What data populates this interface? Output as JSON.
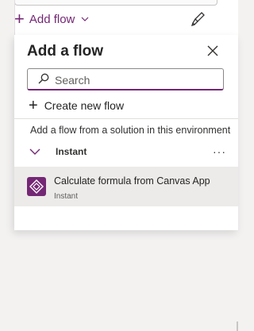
{
  "toolbar": {
    "add_flow_label": "Add flow"
  },
  "flyout": {
    "title": "Add a flow",
    "search": {
      "placeholder": "Search",
      "value": ""
    },
    "create_label": "Create new flow",
    "section_label": "Add a flow from a solution in this environment",
    "group": {
      "label": "Instant",
      "expanded": true,
      "items": [
        {
          "name": "Calculate formula from Canvas App",
          "type": "Instant"
        }
      ]
    }
  },
  "icons": {
    "add": "plus-icon",
    "brush": "brush-icon",
    "close": "close-icon",
    "search": "search-icon",
    "chevron": "chevron-down-icon",
    "more": "more-icon",
    "app": "power-apps-icon"
  },
  "colors": {
    "accent": "#742774",
    "selected_row": "#edebe9"
  }
}
